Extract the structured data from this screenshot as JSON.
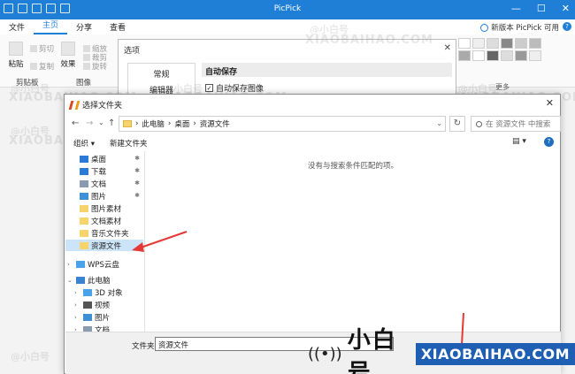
{
  "app": {
    "title": "PicPick",
    "update_notice": "新版本 PicPick 可用",
    "help": "?"
  },
  "ribbon_tabs": [
    "文件",
    "主页",
    "分享",
    "查看"
  ],
  "ribbon": {
    "paste": "粘贴",
    "cut": "剪切",
    "copy": "复制",
    "effects": "效果",
    "scale": "缩放",
    "rotate": "旋转",
    "crop": "裁剪",
    "clipboard_group": "剪贴板",
    "image_group": "图像",
    "more": "更多"
  },
  "options_dialog": {
    "title": "选项",
    "nav": [
      "常规",
      "编辑器"
    ],
    "group_title": "自动保存",
    "checkbox_label": "自动保存图像",
    "checkbox_checked": true
  },
  "folder_dialog": {
    "title": "选择文件夹",
    "breadcrumb": [
      "此电脑",
      "桌面",
      "资源文件"
    ],
    "search_placeholder": "在 资源文件 中搜索",
    "organize": "组织 ▾",
    "new_folder": "新建文件夹",
    "empty_message": "没有与搜索条件匹配的项。",
    "folder_label": "文件夹:",
    "folder_value": "资源文件",
    "sidebar": [
      {
        "label": "桌面",
        "pinned": true,
        "icon": "desktop-icon",
        "color": "#2a7ad6"
      },
      {
        "label": "下载",
        "pinned": true,
        "icon": "download-icon",
        "color": "#2a7ad6"
      },
      {
        "label": "文档",
        "pinned": true,
        "icon": "document-icon",
        "color": "#8a9bb0"
      },
      {
        "label": "图片",
        "pinned": true,
        "icon": "picture-icon",
        "color": "#3d8fd6"
      },
      {
        "label": "图片素材",
        "pinned": false,
        "icon": "folder-icon",
        "color": "#f6d36b"
      },
      {
        "label": "文档素材",
        "pinned": false,
        "icon": "folder-icon",
        "color": "#f6d36b"
      },
      {
        "label": "音乐文件夹",
        "pinned": false,
        "icon": "folder-icon",
        "color": "#f6d36b"
      },
      {
        "label": "资源文件",
        "pinned": false,
        "icon": "folder-icon",
        "color": "#f6d36b",
        "selected": true
      },
      {
        "label": "WPS云盘",
        "pinned": false,
        "icon": "cloud-icon",
        "color": "#4aa3e8",
        "expander": "›"
      },
      {
        "label": "此电脑",
        "pinned": false,
        "icon": "computer-icon",
        "color": "#3a84cf",
        "expander": "⌄"
      },
      {
        "label": "3D 对象",
        "pinned": false,
        "icon": "cube-icon",
        "color": "#4aa3e8",
        "expander": "›"
      },
      {
        "label": "视频",
        "pinned": false,
        "icon": "video-icon",
        "color": "#555",
        "expander": "›"
      },
      {
        "label": "图片",
        "pinned": false,
        "icon": "picture-icon",
        "color": "#3d8fd6",
        "expander": "›"
      },
      {
        "label": "文档",
        "pinned": false,
        "icon": "document-icon",
        "color": "#8a9bb0",
        "expander": "›"
      }
    ]
  },
  "watermark": {
    "cn": "@小白号",
    "en": "XIAOBAIHAO.COM"
  },
  "brand": {
    "cn": "小白号",
    "en": "XIAOBAIHAO.COM"
  },
  "colors": {
    "accent": "#1f7fd6",
    "arrow": "#e53935",
    "selection": "#cce4f7"
  }
}
